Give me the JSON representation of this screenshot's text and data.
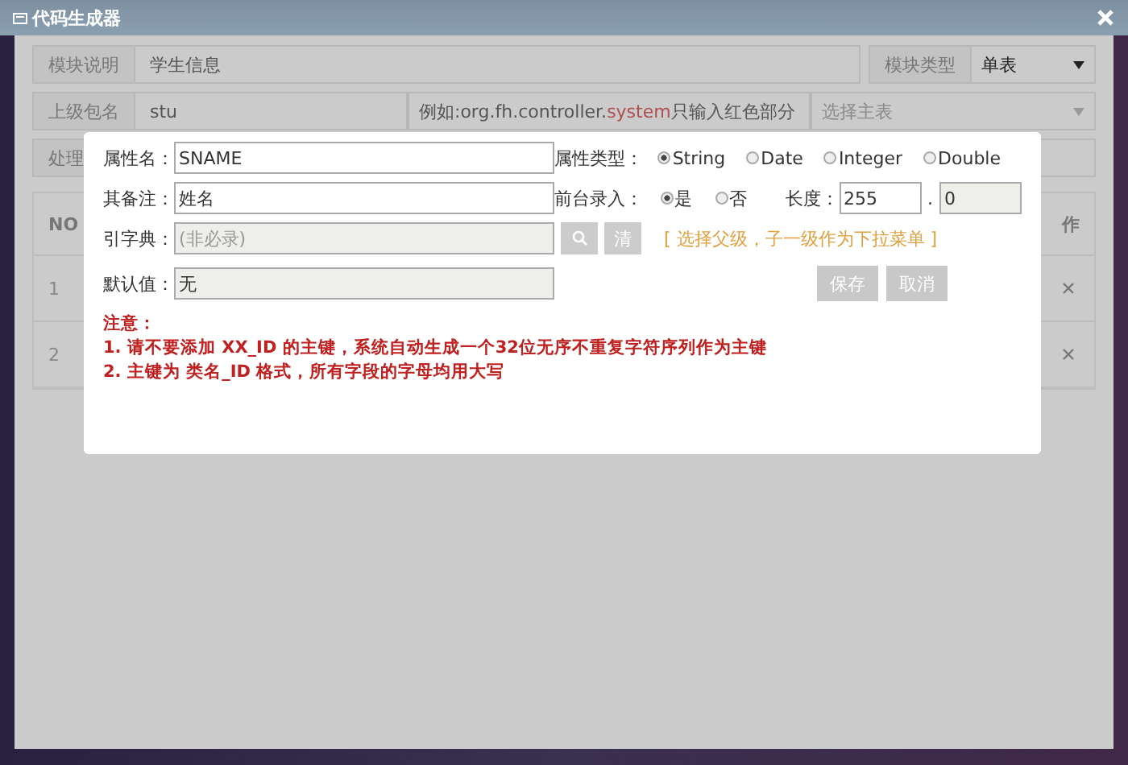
{
  "window": {
    "title": "代码生成器"
  },
  "background_form": {
    "module_desc": {
      "label": "模块说明",
      "value": "学生信息"
    },
    "module_type": {
      "label": "模块类型",
      "value": "单表"
    },
    "package": {
      "label": "上级包名",
      "value": "stu"
    },
    "package_hint": [
      {
        "text": "例如:org.fh.controller.",
        "highlight": false
      },
      {
        "text": "system",
        "highlight": true
      },
      {
        "text": " 只输入红色部分",
        "highlight": false
      }
    ],
    "master_table": {
      "placeholder": "选择主表"
    },
    "process_label": "处理"
  },
  "table": {
    "columns": [
      "NO",
      "作"
    ],
    "rows": [
      {
        "no": "1"
      },
      {
        "no": "2"
      }
    ]
  },
  "dialog": {
    "name": {
      "label": "属性名：",
      "value": "SNAME"
    },
    "comment": {
      "label": "其备注：",
      "value": "姓名"
    },
    "dict": {
      "label": "引字典：",
      "placeholder": "(非必录)",
      "clear": "清"
    },
    "default": {
      "label": "默认值：",
      "value": "无"
    },
    "type": {
      "label": "属性类型：",
      "options": [
        {
          "label": "String",
          "selected": true
        },
        {
          "label": "Date",
          "selected": false
        },
        {
          "label": "Integer",
          "selected": false
        },
        {
          "label": "Double",
          "selected": false
        }
      ]
    },
    "frontend": {
      "label": "前台录入：",
      "options": [
        {
          "label": "是",
          "selected": true
        },
        {
          "label": "否",
          "selected": false
        }
      ]
    },
    "length": {
      "label": "长度：",
      "value": "255",
      "separator": ".",
      "decimal": "0"
    },
    "hint": "[ 选择父级，子一级作为下拉菜单 ]",
    "buttons": [
      {
        "label": "保存"
      },
      {
        "label": "取消"
      }
    ],
    "notes": {
      "title": "注意：",
      "lines": [
        "1. 请不要添加 XX_ID 的主键，系统自动生成一个32位无序不重复字符序列作为主键",
        "2. 主键为 类名_ID 格式，所有字段的字母均用大写"
      ]
    }
  }
}
